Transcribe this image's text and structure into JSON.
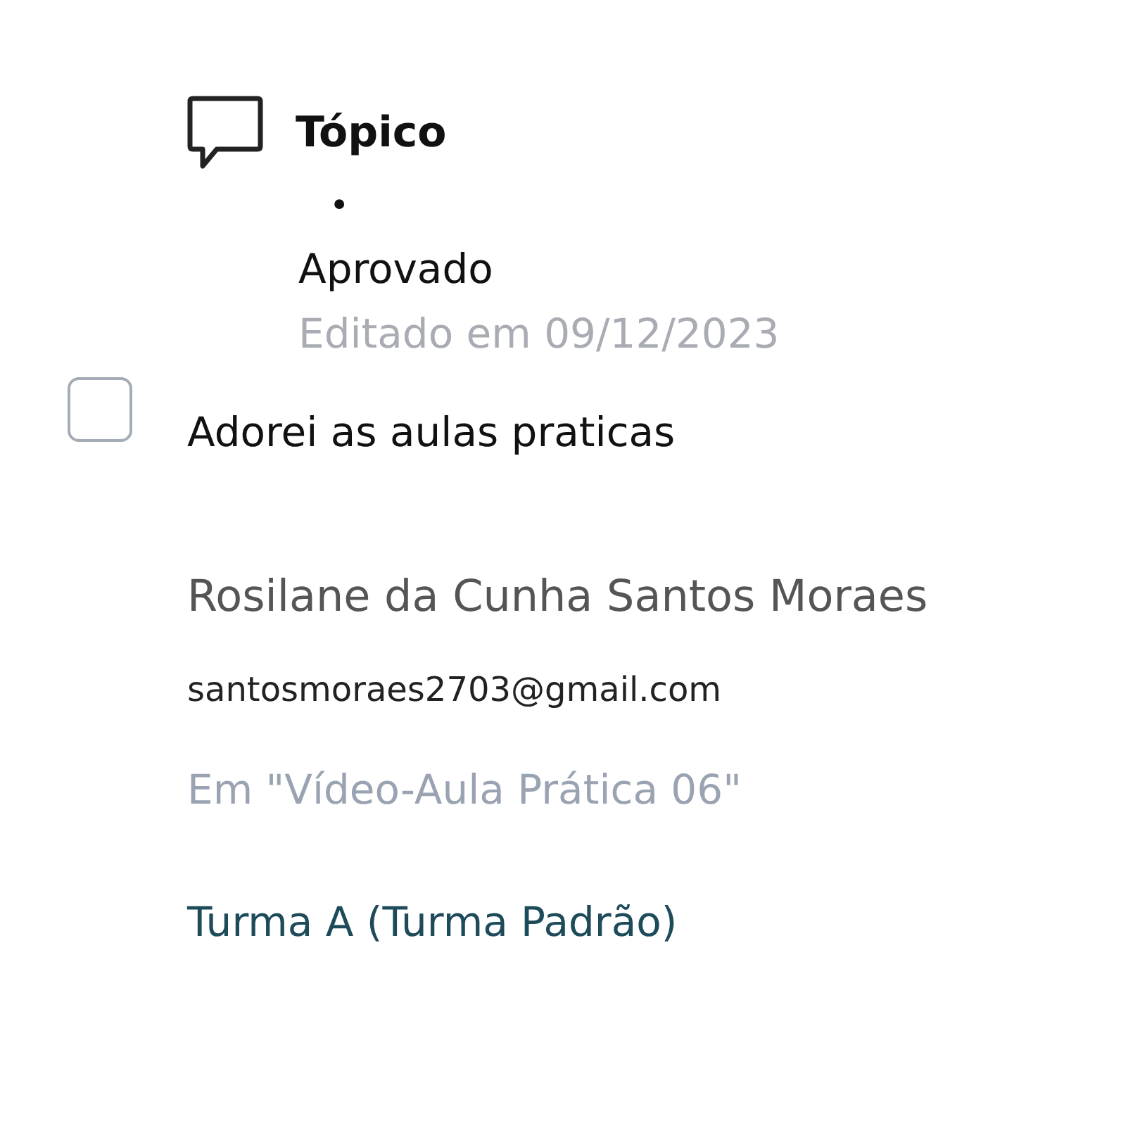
{
  "post": {
    "type": "Tópico",
    "bullet": "•",
    "status": "Aprovado",
    "edited": "Editado em 09/12/2023",
    "checked": false,
    "body": "Adorei as aulas praticas",
    "author": "Rosilane da Cunha Santos Moraes",
    "email": "santosmoraes2703@gmail.com",
    "location": "Em \"Vídeo-Aula Prática 06\"",
    "group": "Turma A (Turma Padrão)"
  }
}
